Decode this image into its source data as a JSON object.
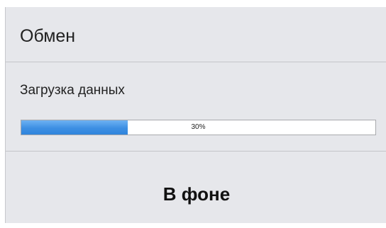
{
  "dialog": {
    "title": "Обмен",
    "status": "Загрузка данных",
    "progress": {
      "value": 0.3,
      "label": "30%"
    },
    "background_button_label": "В фоне"
  },
  "colors": {
    "dialog_background": "#e6e7eb",
    "progress_fill": "#3d8fe3",
    "divider": "#c4c5c9"
  }
}
